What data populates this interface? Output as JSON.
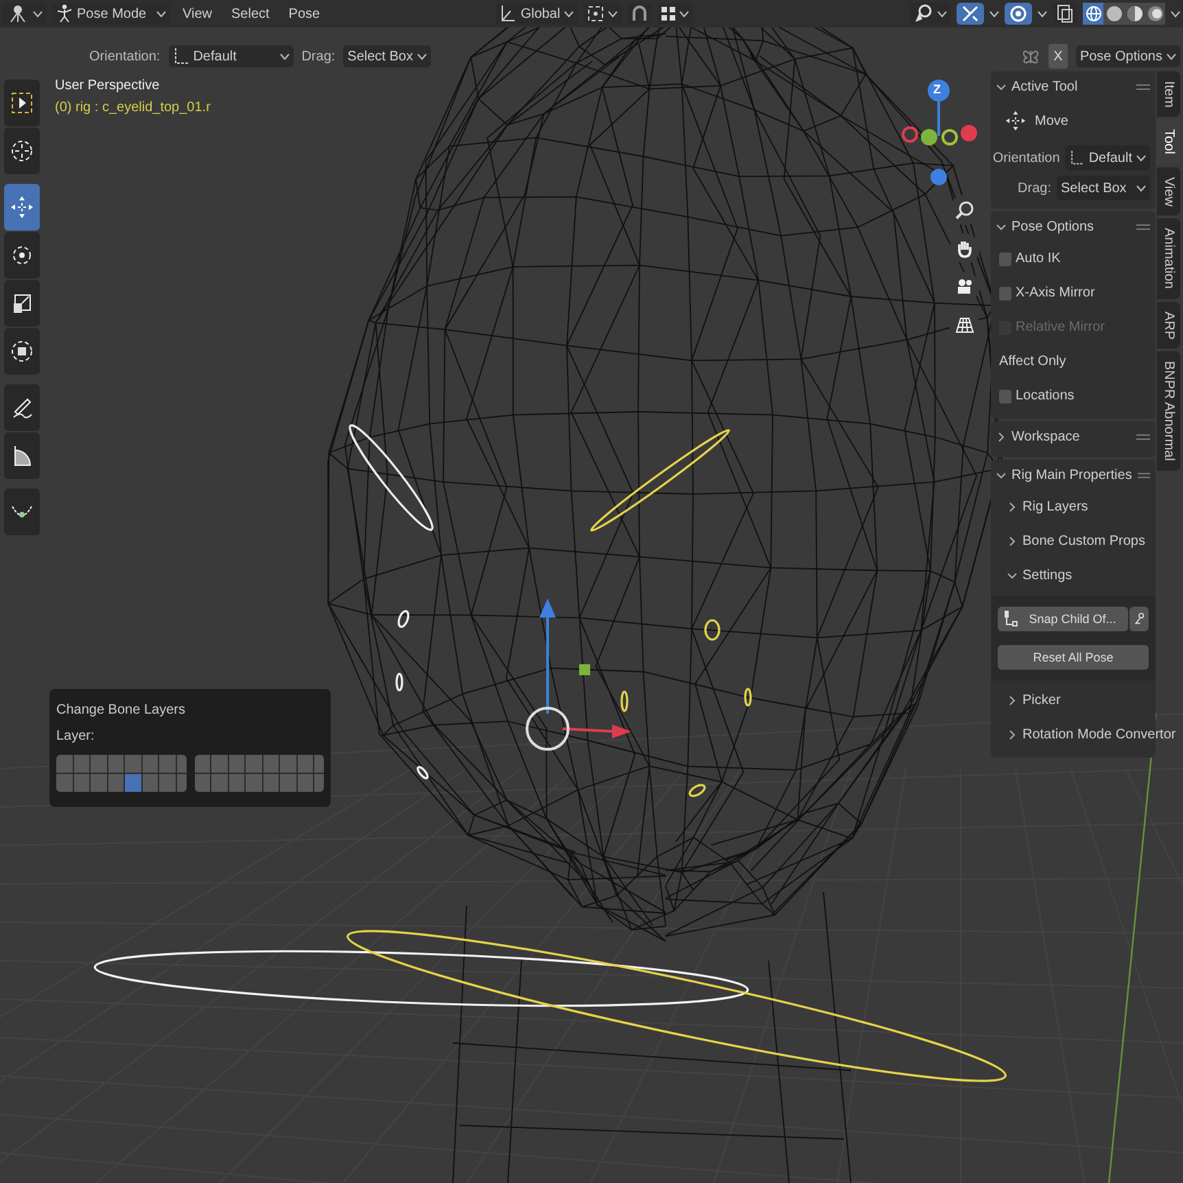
{
  "header": {
    "mode": "Pose Mode",
    "menus": [
      "View",
      "Select",
      "Pose"
    ],
    "orientation": "Global",
    "shading_modes": [
      {
        "kind": "wireframe",
        "selected": true
      },
      {
        "kind": "solid",
        "selected": false
      },
      {
        "kind": "material",
        "selected": false
      },
      {
        "kind": "rendered",
        "selected": false
      }
    ]
  },
  "tool_settings": {
    "orientation_label": "Orientation:",
    "orientation": "Default",
    "drag_label": "Drag:",
    "drag": "Select Box",
    "mirror_axis": "X",
    "options": "Pose Options"
  },
  "toolbar": [
    {
      "kind": "select",
      "selected": false
    },
    {
      "kind": "cursor",
      "selected": false
    },
    {
      "kind": "move",
      "selected": true
    },
    {
      "kind": "rotate",
      "selected": false
    },
    {
      "kind": "scale",
      "selected": false
    },
    {
      "kind": "transform",
      "selected": false
    },
    {
      "kind": "annotate",
      "selected": false
    },
    {
      "kind": "measure",
      "selected": false
    },
    {
      "kind": "bone-size",
      "selected": false
    }
  ],
  "viewport": {
    "title": "User Perspective",
    "active_object": "(0) rig : c_eyelid_top_01.r",
    "gizmo_axis": "Z"
  },
  "bone_layers_panel": {
    "title": "Change Bone Layers",
    "label": "Layer:",
    "layers": [
      {
        "selected": false
      },
      {
        "selected": false
      },
      {
        "selected": false
      },
      {
        "selected": false
      },
      {
        "selected": false
      },
      {
        "selected": false
      },
      {
        "selected": false
      },
      {
        "selected": false
      },
      {
        "selected": false
      },
      {
        "selected": false
      },
      {
        "selected": false
      },
      {
        "selected": false
      },
      {
        "selected": false
      },
      {
        "selected": false
      },
      {
        "selected": false
      },
      {
        "selected": false
      },
      {
        "selected": false
      },
      {
        "selected": false
      },
      {
        "selected": false
      },
      {
        "selected": false
      },
      {
        "selected": true
      },
      {
        "selected": false
      },
      {
        "selected": false
      },
      {
        "selected": false
      },
      {
        "selected": false
      },
      {
        "selected": false
      },
      {
        "selected": false
      },
      {
        "selected": false
      },
      {
        "selected": false
      },
      {
        "selected": false
      },
      {
        "selected": false
      },
      {
        "selected": false
      }
    ]
  },
  "sidebar": {
    "active_tool": {
      "title": "Active Tool",
      "expanded": true,
      "tool": "Move",
      "orientation_label": "Orientation",
      "orientation": "Default",
      "drag_label": "Drag:",
      "drag": "Select Box"
    },
    "pose_options": {
      "title": "Pose Options",
      "expanded": true,
      "items": [
        {
          "kind": "checkbox",
          "label": "Auto IK",
          "checked": false,
          "disabled": false
        },
        {
          "kind": "checkbox",
          "label": "X-Axis Mirror",
          "checked": false,
          "disabled": false
        },
        {
          "kind": "checkbox",
          "label": "Relative Mirror",
          "checked": false,
          "disabled": true
        },
        {
          "kind": "label",
          "label": "Affect Only"
        },
        {
          "kind": "checkbox",
          "label": "Locations",
          "checked": false,
          "disabled": false
        }
      ]
    },
    "workspace": {
      "title": "Workspace",
      "expanded": false
    },
    "rig_main": {
      "title": "Rig Main Properties",
      "expanded": true,
      "subpanels": [
        {
          "title": "Rig Layers",
          "expanded": false
        },
        {
          "title": "Bone Custom Props",
          "expanded": false
        },
        {
          "title": "Settings",
          "expanded": true,
          "snap_button": "Snap Child Of...",
          "reset_button": "Reset All Pose"
        },
        {
          "title": "Picker",
          "expanded": false
        },
        {
          "title": "Rotation Mode Convertor",
          "expanded": false
        }
      ]
    }
  },
  "tabs": [
    {
      "label": "Item",
      "selected": false
    },
    {
      "label": "Tool",
      "selected": true
    },
    {
      "label": "View",
      "selected": false
    },
    {
      "label": "Animation",
      "selected": false
    },
    {
      "label": "ARP",
      "selected": false
    },
    {
      "label": "BNPR Abnormal",
      "selected": false
    }
  ]
}
